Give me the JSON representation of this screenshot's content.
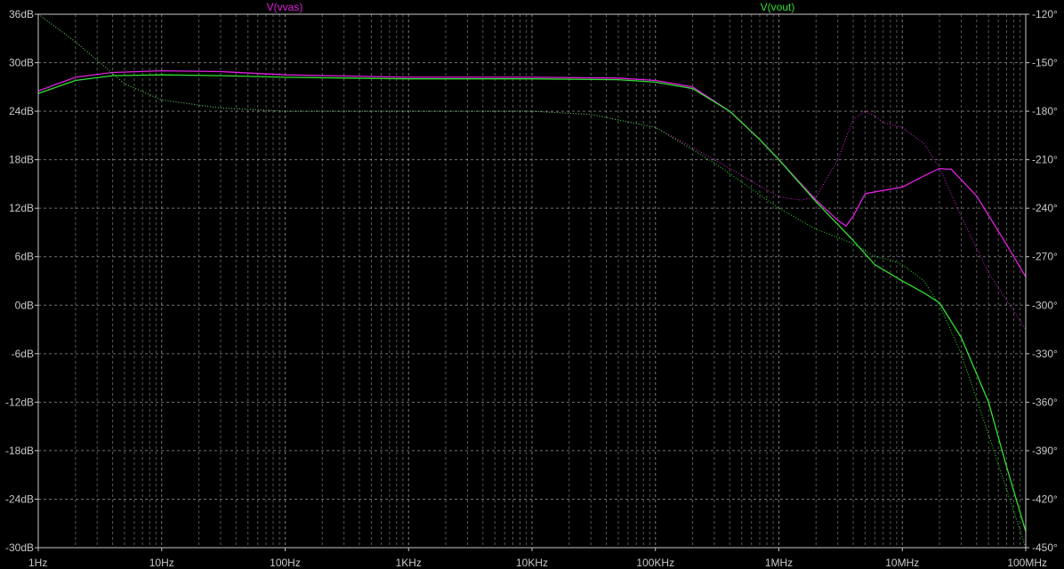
{
  "chart_data": {
    "type": "line",
    "x_scale": "log",
    "xlim_hz": [
      1,
      100000000
    ],
    "x_ticks": [
      {
        "value": 1,
        "label": "1Hz"
      },
      {
        "value": 10,
        "label": "10Hz"
      },
      {
        "value": 100,
        "label": "100Hz"
      },
      {
        "value": 1000,
        "label": "1KHz"
      },
      {
        "value": 10000,
        "label": "10KHz"
      },
      {
        "value": 100000,
        "label": "100KHz"
      },
      {
        "value": 1000000,
        "label": "1MHz"
      },
      {
        "value": 10000000,
        "label": "10MHz"
      },
      {
        "value": 100000000,
        "label": "100MHz"
      }
    ],
    "ylim_db": [
      -30,
      36
    ],
    "y_left_ticks": [
      {
        "value": 36,
        "label": "36dB"
      },
      {
        "value": 30,
        "label": "30dB"
      },
      {
        "value": 24,
        "label": "24dB"
      },
      {
        "value": 18,
        "label": "18dB"
      },
      {
        "value": 12,
        "label": "12dB"
      },
      {
        "value": 6,
        "label": "6dB"
      },
      {
        "value": 0,
        "label": "0dB"
      },
      {
        "value": -6,
        "label": "-6dB"
      },
      {
        "value": -12,
        "label": "-12dB"
      },
      {
        "value": -18,
        "label": "-18dB"
      },
      {
        "value": -24,
        "label": "-24dB"
      },
      {
        "value": -30,
        "label": "-30dB"
      }
    ],
    "ylim_deg": [
      -450,
      -120
    ],
    "y_right_ticks": [
      {
        "value": -120,
        "label": "-120°"
      },
      {
        "value": -150,
        "label": "-150°"
      },
      {
        "value": -180,
        "label": "-180°"
      },
      {
        "value": -210,
        "label": "-210°"
      },
      {
        "value": -240,
        "label": "-240°"
      },
      {
        "value": -270,
        "label": "-270°"
      },
      {
        "value": -300,
        "label": "-300°"
      },
      {
        "value": -330,
        "label": "-330°"
      },
      {
        "value": -360,
        "label": "-360°"
      },
      {
        "value": -390,
        "label": "-390°"
      },
      {
        "value": -420,
        "label": "-420°"
      },
      {
        "value": -450,
        "label": "-450°"
      }
    ],
    "grid": true,
    "background": "#000000",
    "axis_color": "#c8c8c8",
    "grid_color": "#a0a0a0",
    "series": [
      {
        "name": "V(vvas)",
        "color": "#e020e0",
        "magnitude_db": [
          [
            1,
            26.5
          ],
          [
            2,
            28.2
          ],
          [
            4,
            28.8
          ],
          [
            10,
            29.0
          ],
          [
            30,
            28.9
          ],
          [
            100,
            28.5
          ],
          [
            1000,
            28.2
          ],
          [
            10000,
            28.2
          ],
          [
            50000,
            28.1
          ],
          [
            100000,
            27.8
          ],
          [
            200000,
            27.0
          ],
          [
            400000,
            24.0
          ],
          [
            700000,
            20.5
          ],
          [
            1000000,
            18.0
          ],
          [
            2000000,
            13.0
          ],
          [
            3000000,
            10.5
          ],
          [
            3500000,
            9.8
          ],
          [
            4000000,
            11.0
          ],
          [
            5000000,
            13.8
          ],
          [
            7000000,
            14.2
          ],
          [
            10000000,
            14.6
          ],
          [
            15000000,
            16.0
          ],
          [
            20000000,
            16.9
          ],
          [
            25000000,
            16.8
          ],
          [
            40000000,
            13.5
          ],
          [
            70000000,
            7.5
          ],
          [
            100000000,
            3.5
          ]
        ],
        "phase_deg": [
          [
            1,
            -120
          ],
          [
            2,
            -137
          ],
          [
            5,
            -163
          ],
          [
            10,
            -173
          ],
          [
            30,
            -178
          ],
          [
            100,
            -180
          ],
          [
            1000,
            -180
          ],
          [
            10000,
            -180
          ],
          [
            30000,
            -182
          ],
          [
            100000,
            -190
          ],
          [
            300000,
            -210
          ],
          [
            1000000,
            -233
          ],
          [
            1500000,
            -235
          ],
          [
            2000000,
            -233
          ],
          [
            3000000,
            -210
          ],
          [
            4000000,
            -185
          ],
          [
            5000000,
            -180
          ],
          [
            6000000,
            -183
          ],
          [
            7000000,
            -187
          ],
          [
            10000000,
            -190
          ],
          [
            15000000,
            -200
          ],
          [
            20000000,
            -215
          ],
          [
            30000000,
            -245
          ],
          [
            50000000,
            -280
          ],
          [
            100000000,
            -315
          ]
        ]
      },
      {
        "name": "V(vout)",
        "color": "#30e030",
        "magnitude_db": [
          [
            1,
            26.2
          ],
          [
            2,
            27.8
          ],
          [
            4,
            28.4
          ],
          [
            10,
            28.5
          ],
          [
            30,
            28.4
          ],
          [
            100,
            28.2
          ],
          [
            1000,
            28.0
          ],
          [
            10000,
            28.0
          ],
          [
            50000,
            27.9
          ],
          [
            100000,
            27.6
          ],
          [
            200000,
            26.8
          ],
          [
            400000,
            24.0
          ],
          [
            700000,
            20.5
          ],
          [
            1000000,
            18.0
          ],
          [
            2000000,
            12.8
          ],
          [
            3000000,
            10.0
          ],
          [
            4000000,
            8.0
          ],
          [
            6000000,
            5.0
          ],
          [
            10000000,
            3.0
          ],
          [
            15000000,
            1.5
          ],
          [
            20000000,
            0.3
          ],
          [
            30000000,
            -4.0
          ],
          [
            50000000,
            -12.0
          ],
          [
            70000000,
            -20.0
          ],
          [
            100000000,
            -28.0
          ]
        ],
        "phase_deg": [
          [
            1,
            -120
          ],
          [
            2,
            -137
          ],
          [
            5,
            -163
          ],
          [
            10,
            -173
          ],
          [
            30,
            -178
          ],
          [
            100,
            -180
          ],
          [
            1000,
            -180
          ],
          [
            10000,
            -180
          ],
          [
            30000,
            -182
          ],
          [
            100000,
            -190
          ],
          [
            300000,
            -212
          ],
          [
            1000000,
            -240
          ],
          [
            2000000,
            -253
          ],
          [
            3000000,
            -258
          ],
          [
            4000000,
            -262
          ],
          [
            6000000,
            -270
          ],
          [
            8000000,
            -272
          ],
          [
            10000000,
            -275
          ],
          [
            15000000,
            -285
          ],
          [
            20000000,
            -300
          ],
          [
            30000000,
            -330
          ],
          [
            50000000,
            -380
          ],
          [
            100000000,
            -450
          ]
        ]
      }
    ]
  }
}
